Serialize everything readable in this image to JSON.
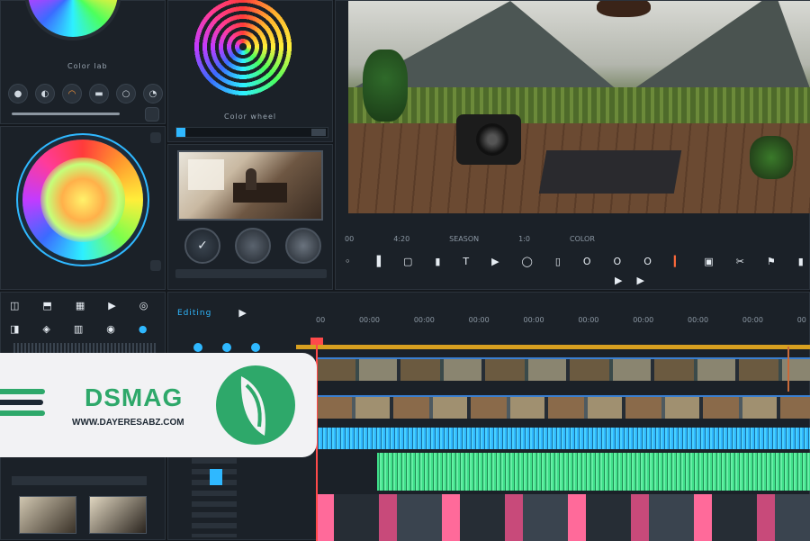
{
  "color_panel": {
    "top_wheel_label": "Color lab",
    "mid_wheel_label": "Color wheel",
    "toolbar_icons": [
      "record-icon",
      "circle-icon",
      "loop-icon",
      "toggle-icon",
      "circle-outline-icon",
      "clock-icon"
    ]
  },
  "preview_small": {
    "controls": [
      "rewind-icon",
      "play-circle-icon",
      "forward-icon"
    ]
  },
  "viewer": {
    "timecode_labels": [
      "00",
      "4:20",
      "SEASON",
      "1:0",
      "COLOR"
    ],
    "transport": [
      "prev",
      "mark",
      "T",
      "play",
      "loop",
      "frame",
      "O",
      "O",
      "O",
      "mark-in",
      "fill",
      "cut",
      "flag",
      "marker"
    ],
    "sub_transport": [
      "play",
      "play"
    ]
  },
  "timeline": {
    "panel_title": "Editing",
    "ruler": [
      "00",
      "00:00",
      "00:00",
      "00:00",
      "00:00",
      "00:00",
      "00:00",
      "00:00",
      "00:00",
      "00"
    ],
    "left_tools": [
      "up-icon",
      "search-icon",
      "split-icon",
      "move-icon",
      "range-icon",
      "blade-icon"
    ]
  },
  "banner": {
    "brand": "DSMAG",
    "url": "WWW.DAYERESABZ.COM",
    "accent": "#2ea86a",
    "bg": "#f2f2f4"
  }
}
